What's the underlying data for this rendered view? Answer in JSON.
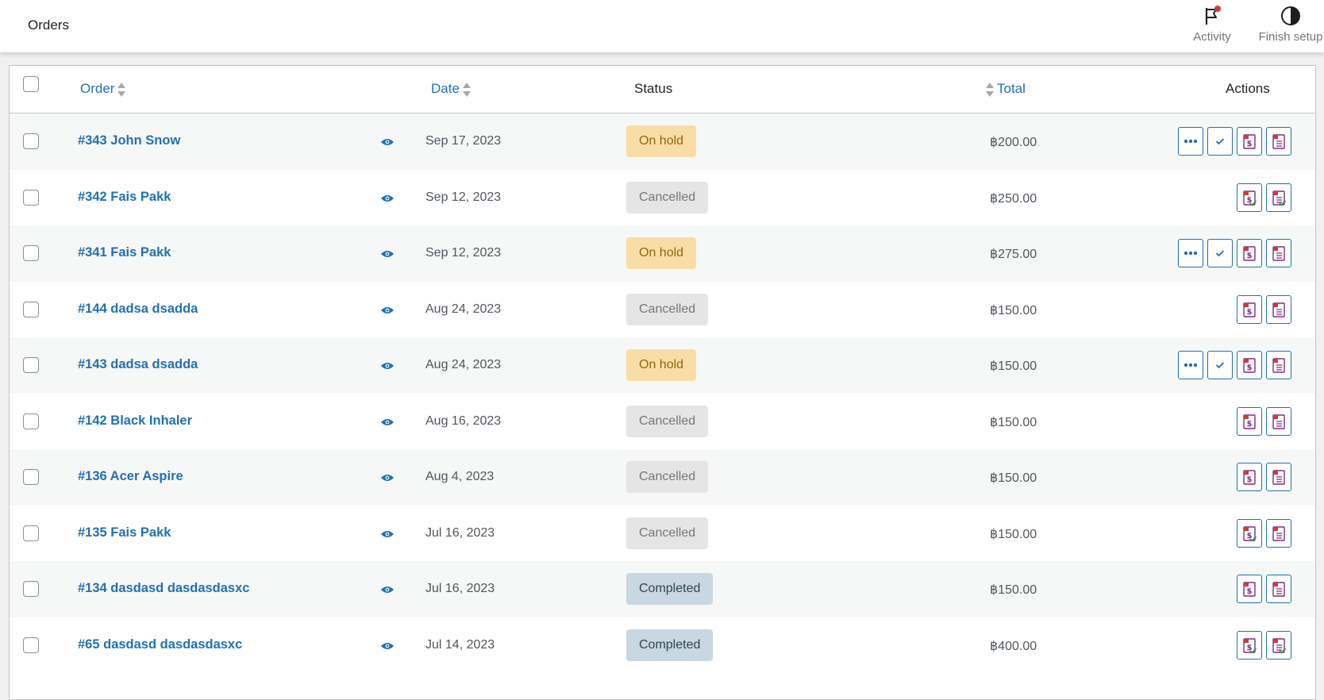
{
  "header": {
    "title": "Orders",
    "activity_label": "Activity",
    "finish_setup_label": "Finish setup"
  },
  "table": {
    "columns": {
      "order": "Order",
      "date": "Date",
      "status": "Status",
      "total": "Total",
      "actions": "Actions"
    },
    "rows": [
      {
        "order": "#343 John Snow",
        "date": "Sep 17, 2023",
        "status": "On hold",
        "status_type": "on-hold",
        "total": "฿200.00",
        "actions": [
          "more",
          "complete",
          "invoice",
          "packing-slip"
        ]
      },
      {
        "order": "#342 Fais Pakk",
        "date": "Sep 12, 2023",
        "status": "Cancelled",
        "status_type": "cancelled",
        "total": "฿250.00",
        "actions": [
          "invoice-checked",
          "packing-slip-checked"
        ]
      },
      {
        "order": "#341 Fais Pakk",
        "date": "Sep 12, 2023",
        "status": "On hold",
        "status_type": "on-hold",
        "total": "฿275.00",
        "actions": [
          "more",
          "complete",
          "invoice",
          "packing-slip"
        ]
      },
      {
        "order": "#144 dadsa dsadda",
        "date": "Aug 24, 2023",
        "status": "Cancelled",
        "status_type": "cancelled",
        "total": "฿150.00",
        "actions": [
          "invoice",
          "packing-slip"
        ]
      },
      {
        "order": "#143 dadsa dsadda",
        "date": "Aug 24, 2023",
        "status": "On hold",
        "status_type": "on-hold",
        "total": "฿150.00",
        "actions": [
          "more",
          "complete",
          "invoice",
          "packing-slip"
        ]
      },
      {
        "order": "#142 Black Inhaler",
        "date": "Aug 16, 2023",
        "status": "Cancelled",
        "status_type": "cancelled",
        "total": "฿150.00",
        "actions": [
          "invoice",
          "packing-slip"
        ]
      },
      {
        "order": "#136 Acer Aspire",
        "date": "Aug 4, 2023",
        "status": "Cancelled",
        "status_type": "cancelled",
        "total": "฿150.00",
        "actions": [
          "invoice",
          "packing-slip"
        ]
      },
      {
        "order": "#135 Fais Pakk",
        "date": "Jul 16, 2023",
        "status": "Cancelled",
        "status_type": "cancelled",
        "total": "฿150.00",
        "actions": [
          "invoice-checked",
          "packing-slip"
        ]
      },
      {
        "order": "#134 dasdasd dasdasdasxc",
        "date": "Jul 16, 2023",
        "status": "Completed",
        "status_type": "completed",
        "total": "฿150.00",
        "actions": [
          "invoice",
          "packing-slip"
        ]
      },
      {
        "order": "#65 dasdasd dasdasdasxc",
        "date": "Jul 14, 2023",
        "status": "Completed",
        "status_type": "completed",
        "total": "฿400.00",
        "actions": [
          "invoice-checked",
          "packing-slip-checked"
        ]
      }
    ]
  },
  "colors": {
    "link": "#2271b1",
    "on_hold_bg": "#f8dda7",
    "cancelled_bg": "#e5e5e5",
    "completed_bg": "#c8d7e1"
  }
}
